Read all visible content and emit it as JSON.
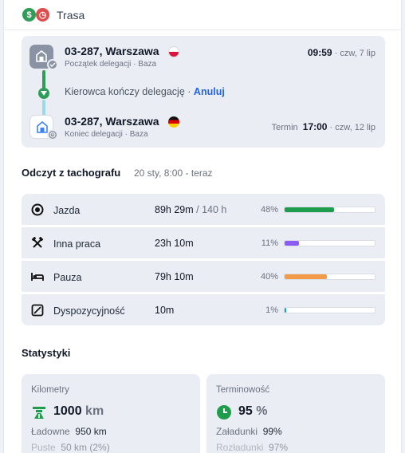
{
  "header": {
    "badges": [
      "$",
      "◷"
    ],
    "title": "Trasa"
  },
  "route": {
    "start": {
      "city": "03-287, Warszawa",
      "country_flag": "pl",
      "subtitle": "Początek delegacji · Baza",
      "time": "09:59",
      "date": "· czw, 7 lip"
    },
    "middle": {
      "text": "Kierowca kończy delegację",
      "separator": "·",
      "action": "Anuluj"
    },
    "end": {
      "city": "03-287, Warszawa",
      "country_flag": "de",
      "subtitle": "Koniec delegacji · Baza",
      "term_label": "Termin",
      "time": "17:00",
      "date": "· czw, 12 lip"
    }
  },
  "tachograph": {
    "title": "Odczyt z tachografu",
    "range": "20 sty, 8:00 - teraz",
    "rows": [
      {
        "icon": "driving-icon",
        "label": "Jazda",
        "value": "89h 29m",
        "limit": "/ 140 h",
        "pct": "48%",
        "fraction": 0.55,
        "color": "#1f9d4c"
      },
      {
        "icon": "other-work-icon",
        "label": "Inna praca",
        "value": "23h 10m",
        "limit": "",
        "pct": "11%",
        "fraction": 0.16,
        "color": "#8b5cf6"
      },
      {
        "icon": "rest-icon",
        "label": "Pauza",
        "value": "79h 10m",
        "limit": "",
        "pct": "40%",
        "fraction": 0.47,
        "color": "#f29a48"
      },
      {
        "icon": "availability-icon",
        "label": "Dyspozycyjność",
        "value": "10m",
        "limit": "",
        "pct": "1%",
        "fraction": 0.02,
        "color": "#16a3b5"
      }
    ]
  },
  "stats": {
    "title": "Statystyki",
    "kilometers": {
      "title": "Kilometry",
      "value": "1000",
      "unit": "km",
      "row1_label": "Ładowne",
      "row1_value": "950 km",
      "row2_label": "Puste",
      "row2_value": "50 km (2%)"
    },
    "timeliness": {
      "title": "Terminowość",
      "value": "95",
      "unit": "%",
      "row1_label": "Załadunki",
      "row1_value": "99%",
      "row2_label": "Rozładunki",
      "row2_value": "97%"
    }
  }
}
